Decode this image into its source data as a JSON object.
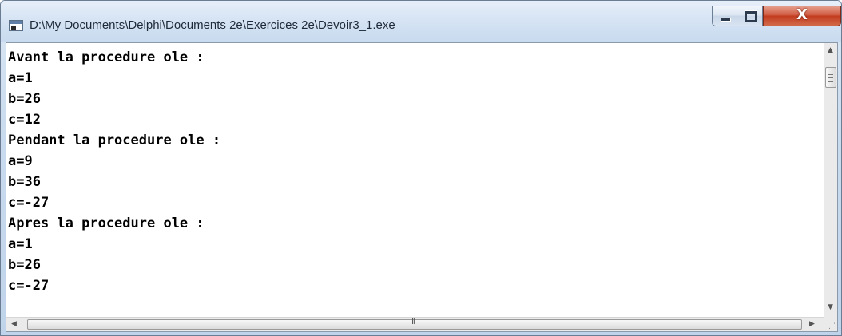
{
  "window": {
    "title": "D:\\My Documents\\Delphi\\Documents 2e\\Exercices 2e\\Devoir3_1.exe",
    "icon": "console-app-icon",
    "buttons": {
      "minimize_icon": "minimize-icon",
      "maximize_icon": "maximize-icon",
      "close_label": "X"
    }
  },
  "console": {
    "lines": [
      "Avant la procedure ole :",
      "a=1",
      "b=26",
      "c=12",
      "Pendant la procedure ole :",
      "a=9",
      "b=36",
      "c=-27",
      "Apres la procedure ole :",
      "a=1",
      "b=26",
      "c=-27"
    ]
  },
  "scrollbars": {
    "up_arrow": "▲",
    "down_arrow": "▼",
    "left_arrow": "◀",
    "right_arrow": "▶",
    "h_grip": "III"
  },
  "colors": {
    "close_button": "#c8452a",
    "titlebar": "#cfdff1",
    "console_background": "#ffffff",
    "console_text": "#000000"
  }
}
